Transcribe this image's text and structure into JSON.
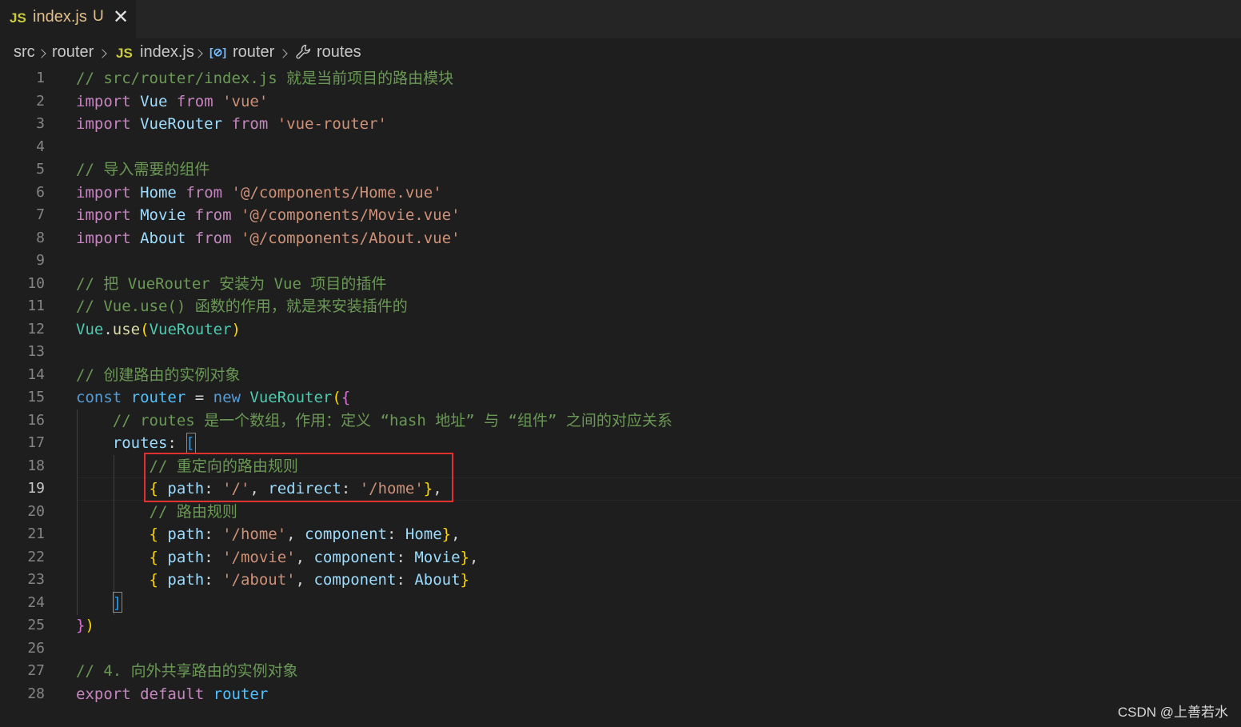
{
  "tab": {
    "icon": "JS",
    "filename": "index.js",
    "status": "U",
    "close_glyph": "✕"
  },
  "breadcrumb": {
    "items": [
      "src",
      "router",
      "index.js",
      "router",
      "routes"
    ],
    "file_icon": "JS",
    "symbol_icon": "[⊘]",
    "icons": [
      "chevron-right-icon",
      "js-file-icon",
      "variable-symbol-icon",
      "wrench-property-icon"
    ]
  },
  "editor": {
    "current_line": 19,
    "lines": [
      {
        "n": "1",
        "tokens": [
          [
            "cm",
            "// src/router/index.js 就是当前项目的路由模块"
          ]
        ]
      },
      {
        "n": "2",
        "tokens": [
          [
            "ctl",
            "import"
          ],
          [
            "pun",
            " "
          ],
          [
            "var",
            "Vue"
          ],
          [
            "pun",
            " "
          ],
          [
            "ctl",
            "from"
          ],
          [
            "pun",
            " "
          ],
          [
            "str",
            "'vue'"
          ]
        ]
      },
      {
        "n": "3",
        "tokens": [
          [
            "ctl",
            "import"
          ],
          [
            "pun",
            " "
          ],
          [
            "var",
            "VueRouter"
          ],
          [
            "pun",
            " "
          ],
          [
            "ctl",
            "from"
          ],
          [
            "pun",
            " "
          ],
          [
            "str",
            "'vue-router'"
          ]
        ]
      },
      {
        "n": "4",
        "tokens": []
      },
      {
        "n": "5",
        "tokens": [
          [
            "cm",
            "// 导入需要的组件"
          ]
        ]
      },
      {
        "n": "6",
        "tokens": [
          [
            "ctl",
            "import"
          ],
          [
            "pun",
            " "
          ],
          [
            "var",
            "Home"
          ],
          [
            "pun",
            " "
          ],
          [
            "ctl",
            "from"
          ],
          [
            "pun",
            " "
          ],
          [
            "str",
            "'@/components/Home.vue'"
          ]
        ]
      },
      {
        "n": "7",
        "tokens": [
          [
            "ctl",
            "import"
          ],
          [
            "pun",
            " "
          ],
          [
            "var",
            "Movie"
          ],
          [
            "pun",
            " "
          ],
          [
            "ctl",
            "from"
          ],
          [
            "pun",
            " "
          ],
          [
            "str",
            "'@/components/Movie.vue'"
          ]
        ]
      },
      {
        "n": "8",
        "tokens": [
          [
            "ctl",
            "import"
          ],
          [
            "pun",
            " "
          ],
          [
            "var",
            "About"
          ],
          [
            "pun",
            " "
          ],
          [
            "ctl",
            "from"
          ],
          [
            "pun",
            " "
          ],
          [
            "str",
            "'@/components/About.vue'"
          ]
        ]
      },
      {
        "n": "9",
        "tokens": []
      },
      {
        "n": "10",
        "tokens": [
          [
            "cm",
            "// 把 VueRouter 安装为 Vue 项目的插件"
          ]
        ]
      },
      {
        "n": "11",
        "tokens": [
          [
            "cm",
            "// Vue.use() 函数的作用，就是来安装插件的"
          ]
        ]
      },
      {
        "n": "12",
        "tokens": [
          [
            "cls",
            "Vue"
          ],
          [
            "pun",
            "."
          ],
          [
            "fn",
            "use"
          ],
          [
            "br1",
            "("
          ],
          [
            "cls",
            "VueRouter"
          ],
          [
            "br1",
            ")"
          ]
        ]
      },
      {
        "n": "13",
        "tokens": []
      },
      {
        "n": "14",
        "tokens": [
          [
            "cm",
            "// 创建路由的实例对象"
          ]
        ]
      },
      {
        "n": "15",
        "tokens": [
          [
            "kw",
            "const"
          ],
          [
            "pun",
            " "
          ],
          [
            "var-c",
            "router"
          ],
          [
            "op",
            " = "
          ],
          [
            "kw",
            "new"
          ],
          [
            "pun",
            " "
          ],
          [
            "cls",
            "VueRouter"
          ],
          [
            "br1",
            "("
          ],
          [
            "br2",
            "{"
          ]
        ]
      },
      {
        "n": "16",
        "tokens": [
          [
            "pun",
            "    "
          ],
          [
            "cm",
            "// routes 是一个数组，作用：定义 “hash 地址” 与 “组件” 之间的对应关系"
          ]
        ]
      },
      {
        "n": "17",
        "tokens": [
          [
            "pun",
            "    "
          ],
          [
            "var",
            "routes"
          ],
          [
            "pun",
            ": "
          ],
          [
            "br3",
            "["
          ]
        ]
      },
      {
        "n": "18",
        "tokens": [
          [
            "pun",
            "        "
          ],
          [
            "cm",
            "// 重定向的路由规则"
          ]
        ]
      },
      {
        "n": "19",
        "tokens": [
          [
            "pun",
            "        "
          ],
          [
            "br1",
            "{"
          ],
          [
            "pun",
            " "
          ],
          [
            "var",
            "path"
          ],
          [
            "pun",
            ": "
          ],
          [
            "str",
            "'/'"
          ],
          [
            "pun",
            ", "
          ],
          [
            "var",
            "redirect"
          ],
          [
            "pun",
            ": "
          ],
          [
            "str",
            "'/home'"
          ],
          [
            "br1",
            "}"
          ],
          [
            "pun",
            ","
          ]
        ]
      },
      {
        "n": "20",
        "tokens": [
          [
            "pun",
            "        "
          ],
          [
            "cm",
            "// 路由规则"
          ]
        ]
      },
      {
        "n": "21",
        "tokens": [
          [
            "pun",
            "        "
          ],
          [
            "br1",
            "{"
          ],
          [
            "pun",
            " "
          ],
          [
            "var",
            "path"
          ],
          [
            "pun",
            ": "
          ],
          [
            "str",
            "'/home'"
          ],
          [
            "pun",
            ", "
          ],
          [
            "var",
            "component"
          ],
          [
            "pun",
            ": "
          ],
          [
            "var",
            "Home"
          ],
          [
            "br1",
            "}"
          ],
          [
            "pun",
            ","
          ]
        ]
      },
      {
        "n": "22",
        "tokens": [
          [
            "pun",
            "        "
          ],
          [
            "br1",
            "{"
          ],
          [
            "pun",
            " "
          ],
          [
            "var",
            "path"
          ],
          [
            "pun",
            ": "
          ],
          [
            "str",
            "'/movie'"
          ],
          [
            "pun",
            ", "
          ],
          [
            "var",
            "component"
          ],
          [
            "pun",
            ": "
          ],
          [
            "var",
            "Movie"
          ],
          [
            "br1",
            "}"
          ],
          [
            "pun",
            ","
          ]
        ]
      },
      {
        "n": "23",
        "tokens": [
          [
            "pun",
            "        "
          ],
          [
            "br1",
            "{"
          ],
          [
            "pun",
            " "
          ],
          [
            "var",
            "path"
          ],
          [
            "pun",
            ": "
          ],
          [
            "str",
            "'/about'"
          ],
          [
            "pun",
            ", "
          ],
          [
            "var",
            "component"
          ],
          [
            "pun",
            ": "
          ],
          [
            "var",
            "About"
          ],
          [
            "br1",
            "}"
          ]
        ]
      },
      {
        "n": "24",
        "tokens": [
          [
            "pun",
            "    "
          ],
          [
            "br3",
            "]"
          ]
        ]
      },
      {
        "n": "25",
        "tokens": [
          [
            "br2",
            "}"
          ],
          [
            "br1",
            ")"
          ]
        ]
      },
      {
        "n": "26",
        "tokens": []
      },
      {
        "n": "27",
        "tokens": [
          [
            "cm",
            "// 4. 向外共享路由的实例对象"
          ]
        ]
      },
      {
        "n": "28",
        "tokens": [
          [
            "ctl",
            "export"
          ],
          [
            "pun",
            " "
          ],
          [
            "ctl",
            "default"
          ],
          [
            "pun",
            " "
          ],
          [
            "var-c",
            "router"
          ]
        ]
      }
    ]
  },
  "colors": {
    "background": "#1e1e1e",
    "highlight_box": "#e03030",
    "comment": "#6a9955",
    "string": "#ce9178",
    "keyword": "#569cd6"
  },
  "watermark": "CSDN @上善若水"
}
